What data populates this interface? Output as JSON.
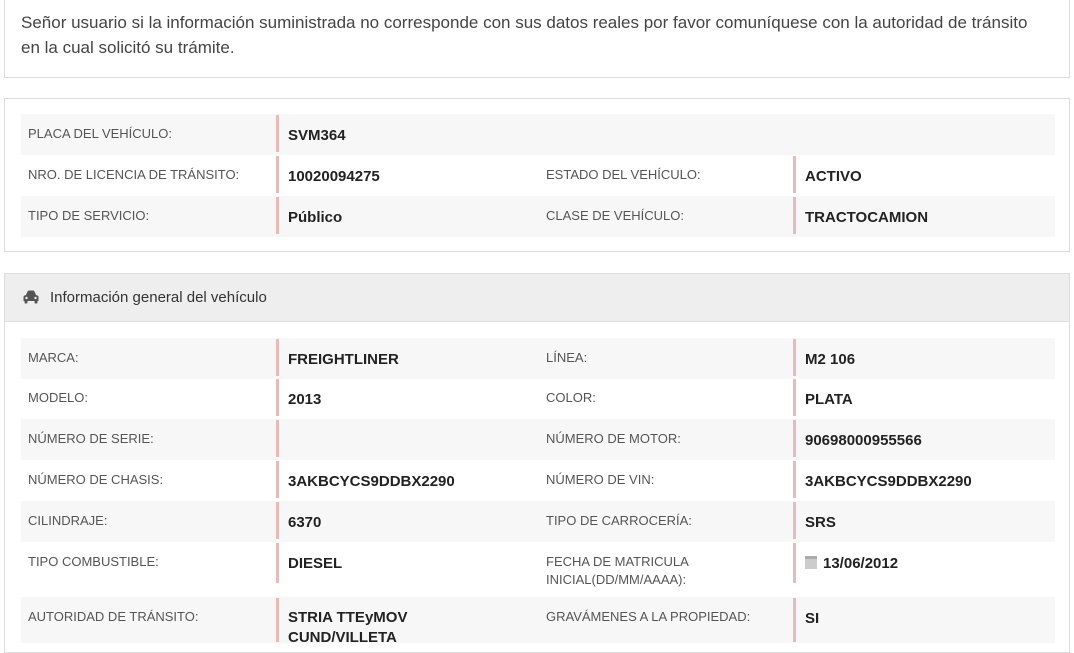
{
  "notice": "Señor usuario si la información suministrada no corresponde con sus datos reales por favor comuníquese con la autoridad de tránsito en la cual solicitó su trámite.",
  "summary": {
    "placa_label": "PLACA DEL VEHÍCULO:",
    "placa": "SVM364",
    "licencia_label": "NRO. DE LICENCIA DE TRÁNSITO:",
    "licencia": "10020094275",
    "estado_label": "ESTADO DEL VEHÍCULO:",
    "estado": "ACTIVO",
    "servicio_label": "TIPO DE SERVICIO:",
    "servicio": "Público",
    "clase_label": "CLASE DE VEHÍCULO:",
    "clase": "TRACTOCAMION"
  },
  "general": {
    "title": "Información general del vehículo",
    "icon": "car-icon",
    "marca_label": "MARCA:",
    "marca": "FREIGHTLINER",
    "linea_label": "LÍNEA:",
    "linea": "M2 106",
    "modelo_label": "MODELO:",
    "modelo": "2013",
    "color_label": "COLOR:",
    "color": "PLATA",
    "serie_label": "NÚMERO DE SERIE:",
    "serie": "",
    "motor_label": "NÚMERO DE MOTOR:",
    "motor": "90698000955566",
    "chasis_label": "NÚMERO DE CHASIS:",
    "chasis": "3AKBCYCS9DDBX2290",
    "vin_label": "NÚMERO DE VIN:",
    "vin": "3AKBCYCS9DDBX2290",
    "cilindraje_label": "CILINDRAJE:",
    "cilindraje": "6370",
    "carroceria_label": "TIPO DE CARROCERÍA:",
    "carroceria": "SRS",
    "combustible_label": "TIPO COMBUSTIBLE:",
    "combustible": "DIESEL",
    "matricula_label": "FECHA DE MATRICULA INICIAL(DD/MM/AAAA):",
    "matricula": "13/06/2012",
    "autoridad_label": "AUTORIDAD DE TRÁNSITO:",
    "autoridad": "STRIA TTEyMOV CUND/VILLETA",
    "gravamenes_label": "GRAVÁMENES A LA PROPIEDAD:",
    "gravamenes": "SI"
  }
}
